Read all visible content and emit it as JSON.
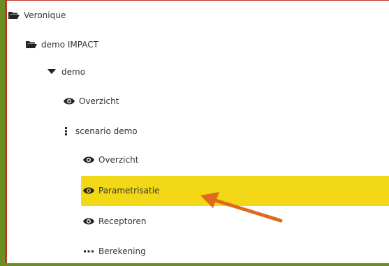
{
  "tree": {
    "root": {
      "label": "Veronique",
      "icon": "folder-open-icon"
    },
    "project": {
      "label": "demo IMPACT",
      "icon": "folder-open-icon"
    },
    "group": {
      "label": "demo",
      "icon": "caret-down-icon"
    },
    "group_overview": {
      "label": "Overzicht",
      "icon": "eye-icon"
    },
    "scenario": {
      "label": "scenario demo",
      "icon": "vertical-ellipsis-icon"
    },
    "scenario_items": [
      {
        "label": "Overzicht",
        "icon": "eye-icon"
      },
      {
        "label": "Parametrisatie",
        "icon": "eye-icon",
        "selected": true
      },
      {
        "label": "Receptoren",
        "icon": "eye-icon"
      },
      {
        "label": "Berekening",
        "icon": "horizontal-ellipsis-icon"
      }
    ]
  },
  "colors": {
    "highlight": "#f2d816",
    "arrow": "#e06a1b",
    "background": "#6b8e23",
    "border": "#c0392b"
  }
}
